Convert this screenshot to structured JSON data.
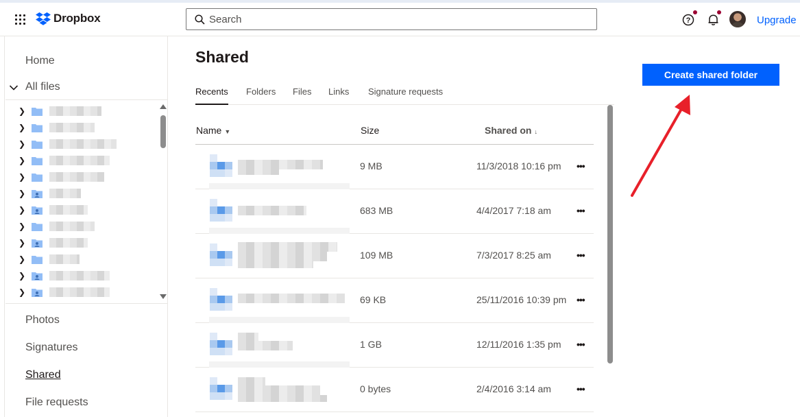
{
  "header": {
    "logo_text": "Dropbox",
    "search_placeholder": "Search",
    "upgrade_label": "Upgrade",
    "icons": [
      "apps-grid-icon",
      "dropbox-logo-icon",
      "search-icon",
      "help-icon",
      "bell-icon",
      "avatar"
    ]
  },
  "sidebar": {
    "home": "Home",
    "all_files": "All files",
    "photos": "Photos",
    "signatures": "Signatures",
    "shared": "Shared",
    "file_requests": "File requests"
  },
  "main": {
    "title": "Shared",
    "create_button": "Create shared folder",
    "tabs": [
      "Recents",
      "Folders",
      "Files",
      "Links",
      "Signature requests"
    ],
    "columns": {
      "name": "Name",
      "size": "Size",
      "shared_on": "Shared on"
    },
    "rows": [
      {
        "size": "9 MB",
        "date": "11/3/2018 10:16 pm",
        "more": "•••"
      },
      {
        "size": "683 MB",
        "date": "4/4/2017 7:18 am",
        "more": "•••"
      },
      {
        "size": "109 MB",
        "date": "7/3/2017 8:25 am",
        "more": "•••"
      },
      {
        "size": "69 KB",
        "date": "25/11/2016 10:39 pm",
        "more": "•••"
      },
      {
        "size": "1 GB",
        "date": "12/11/2016 1:35 pm",
        "more": "•••"
      },
      {
        "size": "0 bytes",
        "date": "2/4/2016 3:14 am",
        "more": "•••"
      }
    ]
  },
  "colors": {
    "accent": "#0061fe",
    "annotation_arrow": "#e8202a"
  }
}
